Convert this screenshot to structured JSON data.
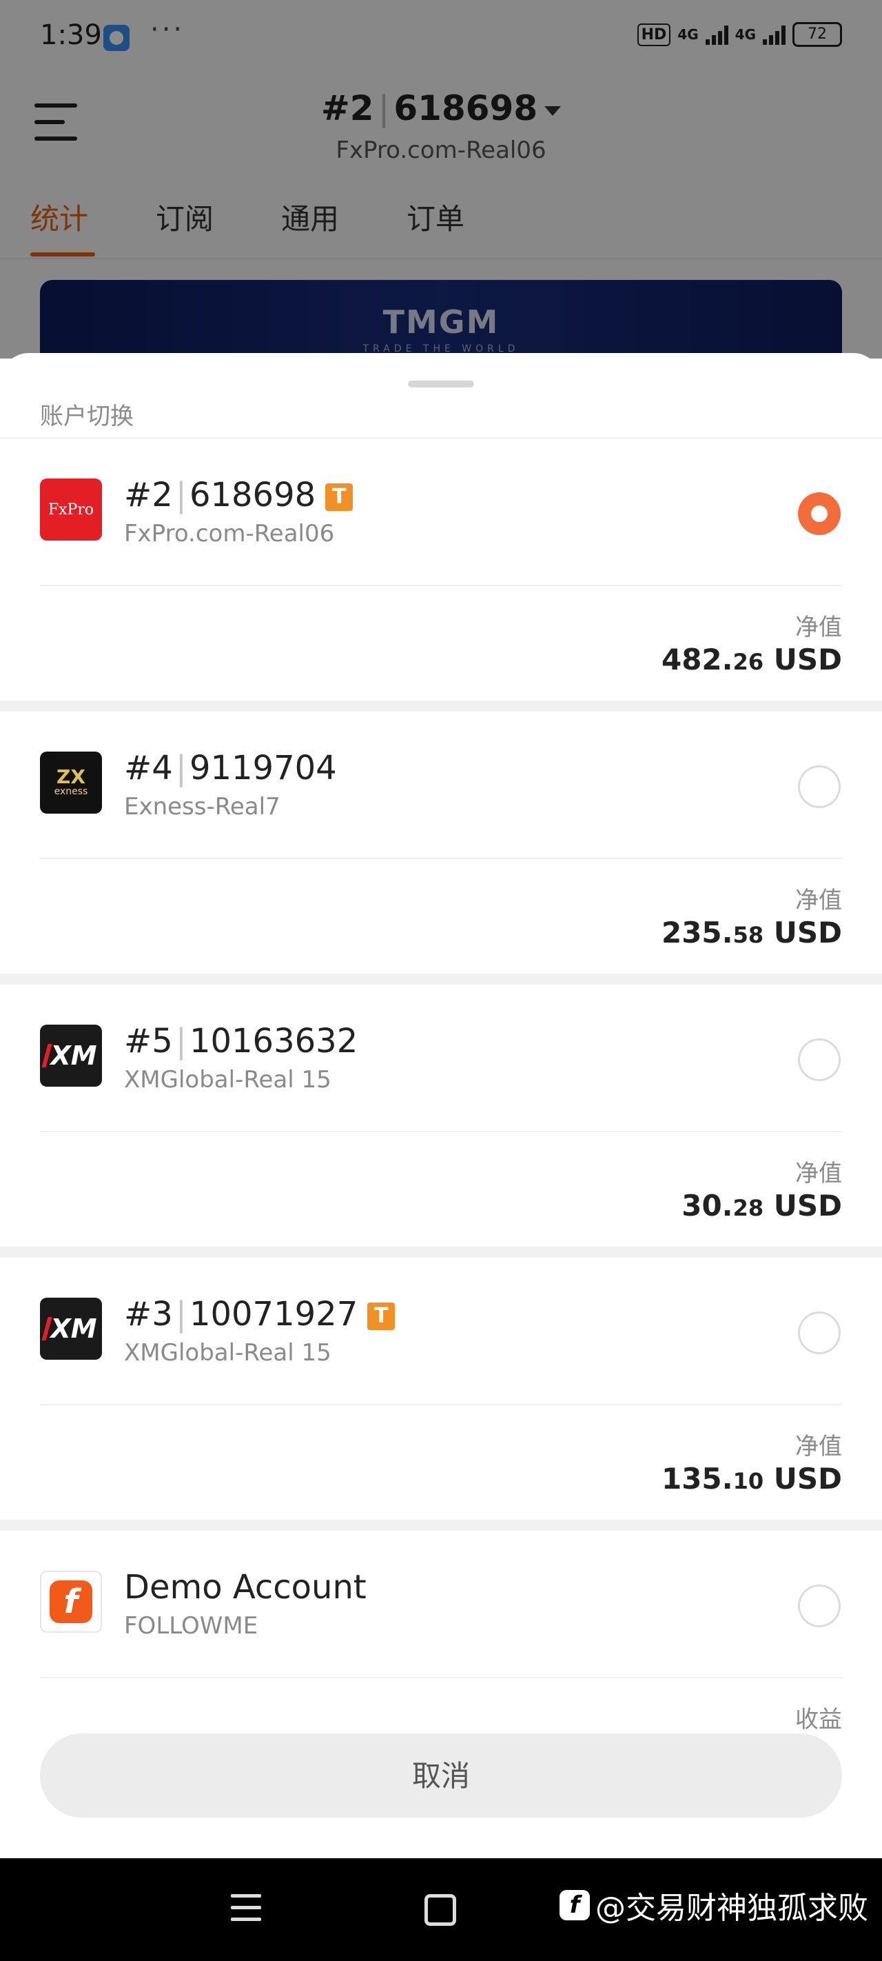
{
  "status_bar": {
    "time": "1:39",
    "dots": "···",
    "hd": "HD",
    "net1": "4G",
    "net2": "4G",
    "battery": "72"
  },
  "header": {
    "account_num": "#2",
    "account_id": "618698",
    "server": "FxPro.com-Real06"
  },
  "tabs": [
    {
      "label": "统计",
      "active": true
    },
    {
      "label": "订阅",
      "active": false
    },
    {
      "label": "通用",
      "active": false
    },
    {
      "label": "订单",
      "active": false
    }
  ],
  "banner": {
    "brand": "TMGM",
    "tagline": "TRADE THE WORLD"
  },
  "sheet": {
    "title": "账户切换",
    "cancel_label": "取消",
    "accounts": [
      {
        "num": "#2",
        "id": "618698",
        "server": "FxPro.com-Real06",
        "badge": "T",
        "logo_text": "FxPro",
        "selected": true,
        "metric_label": "净值",
        "value_int": "482.",
        "value_dec": "26",
        "currency": " USD"
      },
      {
        "num": "#4",
        "id": "9119704",
        "server": "Exness-Real7",
        "badge": "",
        "logo_text": "exness",
        "selected": false,
        "metric_label": "净值",
        "value_int": "235.",
        "value_dec": "58",
        "currency": " USD"
      },
      {
        "num": "#5",
        "id": "10163632",
        "server": "XMGlobal-Real 15",
        "badge": "",
        "logo_text": "XM",
        "selected": false,
        "metric_label": "净值",
        "value_int": "30.",
        "value_dec": "28",
        "currency": " USD"
      },
      {
        "num": "#3",
        "id": "10071927",
        "server": "XMGlobal-Real 15",
        "badge": "T",
        "logo_text": "XM",
        "selected": false,
        "metric_label": "净值",
        "value_int": "135.",
        "value_dec": "10",
        "currency": " USD"
      },
      {
        "name": "Demo Account",
        "server": "FOLLOWME",
        "logo_text": "f",
        "selected": false,
        "metric_label": "收益"
      }
    ]
  },
  "watermark": {
    "logo": "f",
    "text": "@交易财神独孤求败"
  },
  "colors": {
    "accent": "#e8600c",
    "radio_selected": "#f26d3a",
    "badge": "#f29025"
  }
}
